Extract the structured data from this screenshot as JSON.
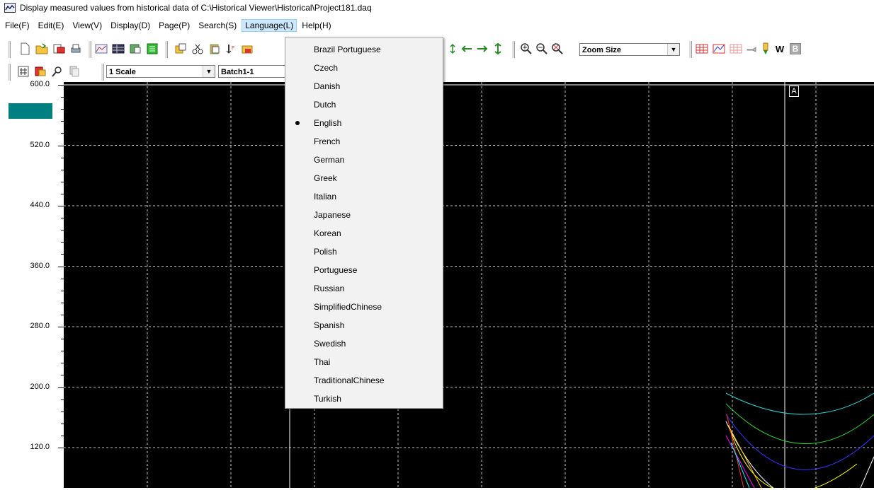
{
  "window": {
    "title": "Display measured values from historical data of C:\\Historical Viewer\\Historical\\Project181.daq"
  },
  "menubar": {
    "items": [
      {
        "label": "File(F)"
      },
      {
        "label": "Edit(E)"
      },
      {
        "label": "View(V)"
      },
      {
        "label": "Display(D)"
      },
      {
        "label": "Page(P)"
      },
      {
        "label": "Search(S)"
      },
      {
        "label": "Language(L)"
      },
      {
        "label": "Help(H)"
      }
    ],
    "active": "Language(L)"
  },
  "toolbar": {
    "zoom_combo": "Zoom Size",
    "w_button": "W",
    "b_button": "B",
    "scale_combo": "1 Scale",
    "batch_combo": "Batch1-1"
  },
  "cursor_marker": {
    "label": "A"
  },
  "language_menu": {
    "items": [
      {
        "label": "Brazil Portuguese",
        "checked": false
      },
      {
        "label": "Czech",
        "checked": false
      },
      {
        "label": "Danish",
        "checked": false
      },
      {
        "label": "Dutch",
        "checked": false
      },
      {
        "label": "English",
        "checked": true
      },
      {
        "label": "French",
        "checked": false
      },
      {
        "label": "German",
        "checked": false
      },
      {
        "label": "Greek",
        "checked": false
      },
      {
        "label": "Italian",
        "checked": false
      },
      {
        "label": "Japanese",
        "checked": false
      },
      {
        "label": "Korean",
        "checked": false
      },
      {
        "label": "Polish",
        "checked": false
      },
      {
        "label": "Portuguese",
        "checked": false
      },
      {
        "label": "Russian",
        "checked": false
      },
      {
        "label": "SimplifiedChinese",
        "checked": false
      },
      {
        "label": "Spanish",
        "checked": false
      },
      {
        "label": "Swedish",
        "checked": false
      },
      {
        "label": "Thai",
        "checked": false
      },
      {
        "label": "TraditionalChinese",
        "checked": false
      },
      {
        "label": "Turkish",
        "checked": false
      }
    ]
  },
  "chart": {
    "y_ticks": [
      "600.0",
      "520.0",
      "440.0",
      "360.0",
      "280.0",
      "200.0",
      "120.0"
    ],
    "background": "#000000",
    "grid_color": "#c0c0c0",
    "channel_indicator_color": "#008080"
  }
}
